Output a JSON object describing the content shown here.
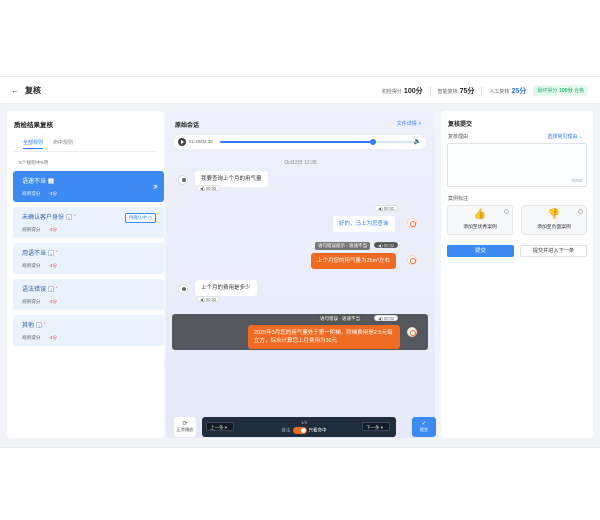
{
  "header": {
    "back_icon": "arrow-left-icon",
    "title": "复核",
    "scores": [
      {
        "label": "初检得分",
        "value": "100分"
      },
      {
        "label": "智能复核",
        "value": "75分"
      },
      {
        "label": "人工复核",
        "value": "25分"
      }
    ],
    "final": {
      "label": "最终得分",
      "value": "100分",
      "status": "合格"
    }
  },
  "left": {
    "title": "质检结果复核",
    "tabs": [
      "全部规则",
      "命中规则"
    ],
    "count_text": "5个规则中5项",
    "items": [
      {
        "name": "语速不当",
        "badge": "2",
        "meta_label": "规则得分",
        "meta_value": "-3分",
        "active": true
      },
      {
        "name": "未确认客户身份",
        "badge": "1",
        "sup": "*",
        "meta_label": "规则得分",
        "meta_value": "-3分",
        "pending": "待确认中"
      },
      {
        "name": "用语不当",
        "badge": "1",
        "sup": "*",
        "meta_label": "规则得分",
        "meta_value": "-3分"
      },
      {
        "name": "语法错误",
        "badge": "1",
        "sup": "*",
        "meta_label": "规则得分",
        "meta_value": "-3分"
      },
      {
        "name": "其他",
        "badge": "1",
        "sup": "*",
        "meta_label": "规则得分",
        "meta_value": "-3分"
      }
    ]
  },
  "center": {
    "title": "原始会话",
    "detail_link": "文件详情 >",
    "player": {
      "time": "01:20/02:30",
      "progress": 0.79
    },
    "timestamp": "Oct12日 12:35",
    "messages": [
      {
        "role": "user",
        "text": "我要查询上个月的用气量",
        "duration": "00:02"
      },
      {
        "role": "agent",
        "text": "好的，马上为您查询",
        "duration": "00:02"
      },
      {
        "role": "agent",
        "tag": "语句错误提示 - 语速不当",
        "text": "上个月您的用气量为25m³左右",
        "duration": "00:02",
        "highlight": true
      },
      {
        "role": "user",
        "text": "上个月的费用是多少",
        "duration": "00:02"
      },
      {
        "role": "agent",
        "tag": "语句错误 - 语速不当",
        "text": "2025年3月您的用气量处于第一阶梯，阶梯费用是2.5元每立方，综合计算您上月费用为30元",
        "duration": "00:02"
      }
    ],
    "controls": {
      "refresh_label": "正常播放",
      "prev_label": "上一条",
      "next_label": "下一条",
      "page": "1/2",
      "toggle_prefix": "备注",
      "toggle_label": "只看命中",
      "submit_label": "提交"
    }
  },
  "right": {
    "title": "复核提交",
    "reason_label": "复核理由",
    "reason_link": "选择常见理由",
    "counter": "0/200",
    "example_label": "案例标注",
    "examples": [
      "添加至优秀案例",
      "添加至负面案例"
    ],
    "submit_btn": "提交",
    "submit_next_btn": "提交并进入下一条"
  },
  "colors": {
    "primary": "#3d8bf2",
    "orange": "#f06b22",
    "success": "#2bb673",
    "dark": "#1f2d3d"
  }
}
